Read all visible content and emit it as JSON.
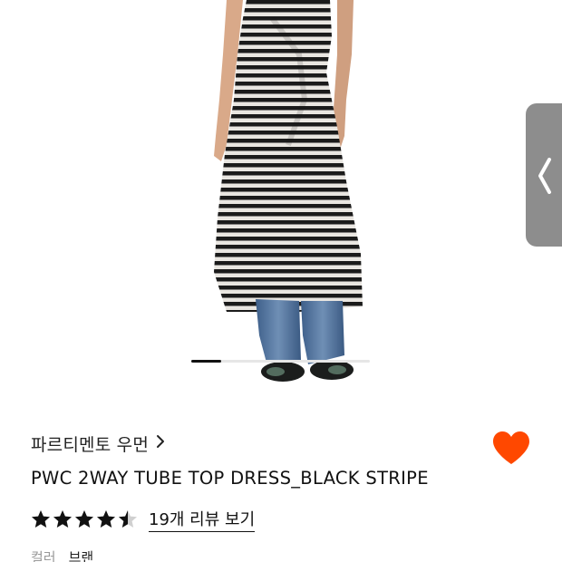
{
  "gallery": {
    "image_alt": "model wearing black and white striped tube top dress over jeans",
    "slide_progress": 0.17
  },
  "side_tab": {
    "icon": "chevron-left-icon"
  },
  "product": {
    "brand": "파르티멘토 우먼",
    "brand_icon": "chevron-right-icon",
    "title": "PWC 2WAY TUBE TOP DRESS_BLACK STRIPE",
    "rating": 4.5,
    "review_link": "19개 리뷰 보기",
    "wishlist_icon": "heart-icon",
    "wishlist_color": "#ff4800"
  },
  "meta": {
    "label": "컬러",
    "value": "브랜"
  }
}
